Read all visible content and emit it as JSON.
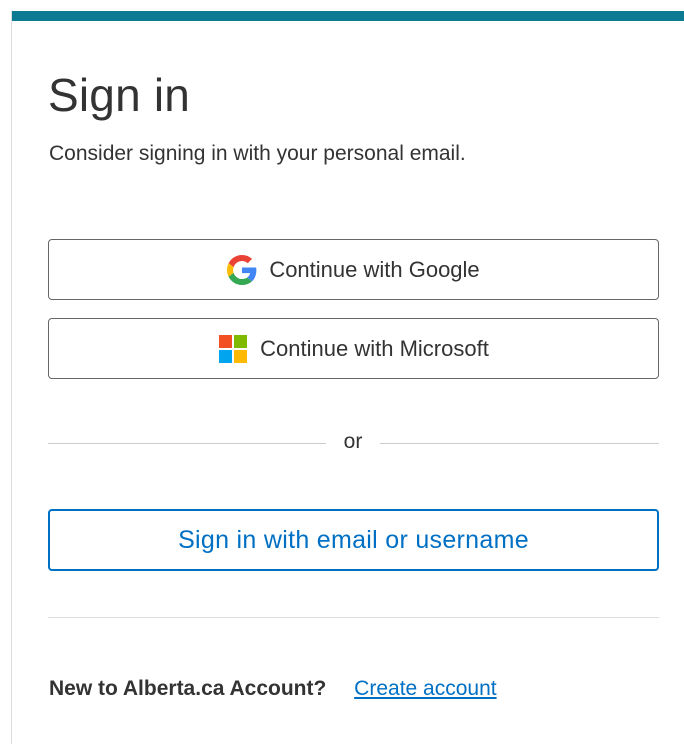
{
  "header": {
    "title": "Sign in",
    "subtitle": "Consider signing in with your personal email."
  },
  "providers": {
    "google": {
      "label": "Continue with Google",
      "icon": "google-icon"
    },
    "microsoft": {
      "label": "Continue with Microsoft",
      "icon": "microsoft-icon"
    }
  },
  "divider": {
    "text": "or"
  },
  "email_signin": {
    "label": "Sign in with email or username"
  },
  "footer": {
    "new_account_text": "New to Alberta.ca Account?",
    "create_account_link": "Create account"
  },
  "colors": {
    "accent_bar": "#0b7a93",
    "primary_link": "#0070c4",
    "text": "#333333",
    "google_blue": "#4285F4",
    "google_red": "#EA4335",
    "google_yellow": "#FBBC05",
    "google_green": "#34A853",
    "ms_red": "#F25022",
    "ms_green": "#7FBA00",
    "ms_blue": "#00A4EF",
    "ms_yellow": "#FFB900"
  }
}
